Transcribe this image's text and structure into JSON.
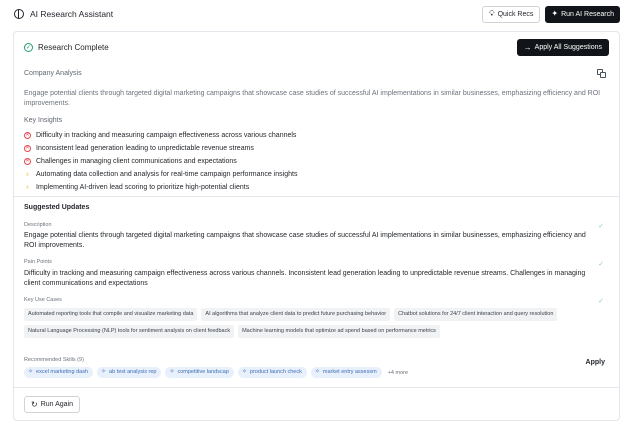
{
  "header": {
    "title": "AI Research Assistant",
    "quick_recs_label": "Quick Recs",
    "run_label": "Run AI Research"
  },
  "result": {
    "status": "Research Complete",
    "apply_all_label": "Apply All Suggestions",
    "analysis_label": "Company Analysis",
    "analysis_text": "Engage potential clients through targeted digital marketing campaigns that showcase case studies of successful AI implementations in similar businesses, emphasizing efficiency and ROI improvements.",
    "insights_label": "Key Insights",
    "insights": [
      {
        "type": "problem",
        "icon": "x-circle-icon",
        "text": "Difficulty in tracking and measuring campaign effectiveness across various channels"
      },
      {
        "type": "problem",
        "icon": "x-circle-icon",
        "text": "Inconsistent lead generation leading to unpredictable revenue streams"
      },
      {
        "type": "problem",
        "icon": "x-circle-icon",
        "text": "Challenges in managing client communications and expectations"
      },
      {
        "type": "opportunity",
        "icon": "lightbulb-icon",
        "text": "Automating data collection and analysis for real-time campaign performance insights"
      },
      {
        "type": "opportunity",
        "icon": "lightbulb-icon",
        "text": "Implementing AI-driven lead scoring to prioritize high-potential clients"
      }
    ]
  },
  "suggestions": {
    "title": "Suggested Updates",
    "description_label": "Description",
    "description_value": "Engage potential clients through targeted digital marketing campaigns that showcase case studies of successful AI implementations in similar businesses, emphasizing efficiency and ROI improvements.",
    "pain_points_label": "Pain Points",
    "pain_points_value": "Difficulty in tracking and measuring campaign effectiveness across various channels. Inconsistent lead generation leading to unpredictable revenue streams. Challenges in managing client communications and expectations",
    "use_cases_label": "Key Use Cases",
    "use_cases": [
      "Automated reporting tools that compile and visualize marketing data",
      "AI algorithms that analyze client data to predict future purchasing behavior",
      "Chatbot solutions for 24/7 client interaction and query resolution",
      "Natural Language Processing (NLP) tools for sentiment analysis on client feedback",
      "Machine learning models that optimize ad spend based on performance metrics"
    ],
    "skills_label": "Recommended Skills (9)",
    "skills": [
      "excel marketing dash",
      "ab test analysis rep",
      "competitive landscap",
      "product launch check",
      "market entry assessm"
    ],
    "more_label": "+4 more",
    "apply_label": "Apply",
    "run_again_label": "Run Again"
  },
  "colors": {
    "primary_button": "#111418",
    "success": "#22a06b",
    "problem": "#e5484d",
    "opportunity": "#e6b422",
    "skill_chip": "#e8f0fb"
  }
}
